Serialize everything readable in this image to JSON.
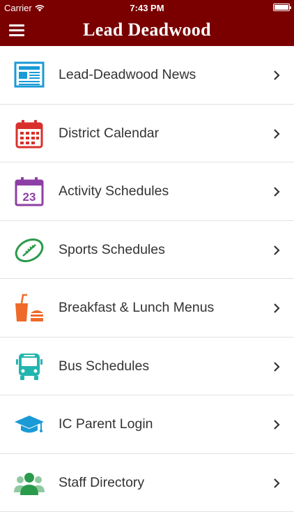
{
  "status_bar": {
    "carrier": "Carrier",
    "time": "7:43 PM",
    "battery_level": 1.0
  },
  "nav_bar": {
    "title": "Lead Deadwood",
    "menu_icon": "hamburger-icon"
  },
  "colors": {
    "header": "#7a0000",
    "news": "#1a9ad6",
    "calendar": "#d9302c",
    "activity": "#8e3fa5",
    "sports": "#2a9a4b",
    "menus": "#ef6a2a",
    "bus": "#22b5b0",
    "login": "#1a9ad6",
    "staff": "#2a9a4b"
  },
  "menu_items": [
    {
      "label": "Lead-Deadwood News",
      "icon": "newspaper-icon"
    },
    {
      "label": "District Calendar",
      "icon": "calendar-icon"
    },
    {
      "label": "Activity Schedules",
      "icon": "calendar-23-icon",
      "icon_text": "23"
    },
    {
      "label": "Sports Schedules",
      "icon": "football-icon"
    },
    {
      "label": "Breakfast & Lunch Menus",
      "icon": "drink-burger-icon"
    },
    {
      "label": "Bus Schedules",
      "icon": "bus-icon"
    },
    {
      "label": "IC Parent Login",
      "icon": "graduation-cap-icon"
    },
    {
      "label": "Staff Directory",
      "icon": "people-icon"
    }
  ]
}
